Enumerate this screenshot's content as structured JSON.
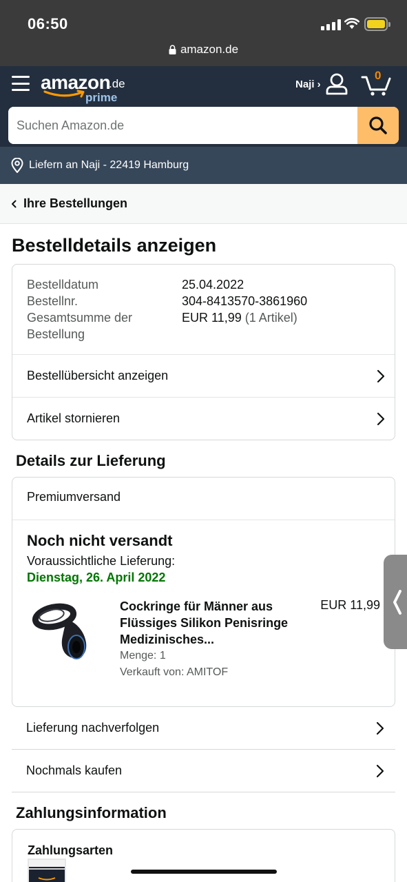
{
  "status_bar": {
    "time": "06:50",
    "url": "amazon.de"
  },
  "header": {
    "logo_word": "amazon",
    "logo_tld": ".de",
    "logo_sub": "prime",
    "account_label": "Naji ›",
    "cart_count": "0",
    "search_placeholder": "Suchen Amazon.de",
    "deliver_to": "Liefern an Naji - 22419 Hamburg",
    "accent_color": "#febd69"
  },
  "breadcrumb": {
    "label": "Ihre Bestellungen"
  },
  "page_title": "Bestelldetails anzeigen",
  "order": {
    "date_label": "Bestelldatum",
    "date_value": "25.04.2022",
    "number_label": "Bestellnr.",
    "number_value": "304-8413570-3861960",
    "total_label_line1": "Gesamtsumme der",
    "total_label_line2": "Bestellung",
    "total_value": "EUR 11,99",
    "total_items": "(1 Artikel)",
    "links": [
      "Bestellübersicht anzeigen",
      "Artikel stornieren"
    ]
  },
  "delivery": {
    "section_title": "Details zur Lieferung",
    "shipping_type": "Premiumversand",
    "status": "Noch nicht versandt",
    "eta_label": "Voraussichtliche Lieferung:",
    "eta_date": "Dienstag, 26. April 2022",
    "product": {
      "title_line1": "Cockringe für Männer aus",
      "title_line2": "Flüssiges Silikon Penisringe",
      "title_line3": "Medizinisches...",
      "price": "EUR 11,99",
      "quantity": "Menge: 1",
      "seller": "Verkauft von: AMITOF"
    },
    "links": [
      "Lieferung nachverfolgen",
      "Nochmals kaufen"
    ]
  },
  "payment": {
    "section_title": "Zahlungsinformation",
    "methods_label": "Zahlungsarten"
  }
}
